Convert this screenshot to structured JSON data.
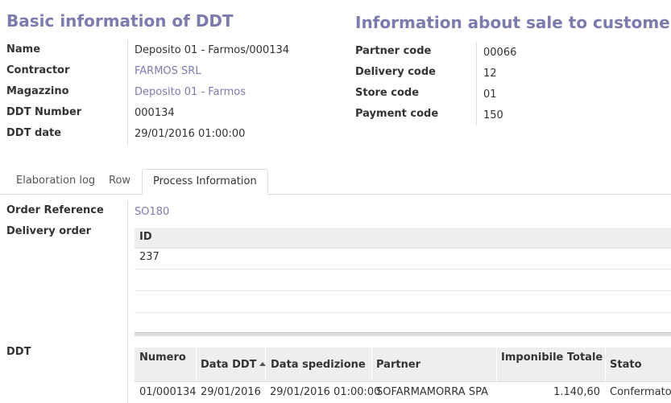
{
  "basic": {
    "title": "Basic information of DDT",
    "fields": [
      {
        "label": "Name",
        "value": "Deposito 01 - Farmos/000134"
      },
      {
        "label": "Contractor",
        "value": "FARMOS SRL"
      },
      {
        "label": "Magazzino",
        "value": "Deposito 01 - Farmos"
      },
      {
        "label": "DDT Number",
        "value": "000134"
      },
      {
        "label": "DDT date",
        "value": "29/01/2016 01:00:00"
      }
    ]
  },
  "sale": {
    "title": "Information about sale to customer",
    "fields": [
      {
        "label": "Partner code",
        "value": "00066"
      },
      {
        "label": "Delivery code",
        "value": "12"
      },
      {
        "label": "Store code",
        "value": "01"
      },
      {
        "label": "Payment code",
        "value": "150"
      }
    ]
  },
  "tabs": [
    {
      "label": "Elaboration log"
    },
    {
      "label": "Row"
    },
    {
      "label": "Process Information"
    }
  ],
  "process": {
    "order_reference_label": "Order Reference",
    "order_reference_value": "SO180",
    "delivery_order_label": "Delivery order",
    "delivery_table": {
      "header": "ID",
      "rows": [
        "237"
      ]
    },
    "ddt_label": "DDT",
    "ddt_table": {
      "columns": [
        "Numero",
        "Data DDT",
        "Data spedizione",
        "Partner",
        "Imponibile Totale",
        "Stato"
      ],
      "rows": [
        [
          "01/000134",
          "29/01/2016",
          "29/01/2016 01:00:00",
          "SOFARMAMORRA SPA",
          "1.140,60",
          "Confermato"
        ]
      ]
    }
  },
  "colors": {
    "accent": "#7c7bad",
    "header_bg": "#eeeeee",
    "border": "#dcdcdc"
  }
}
